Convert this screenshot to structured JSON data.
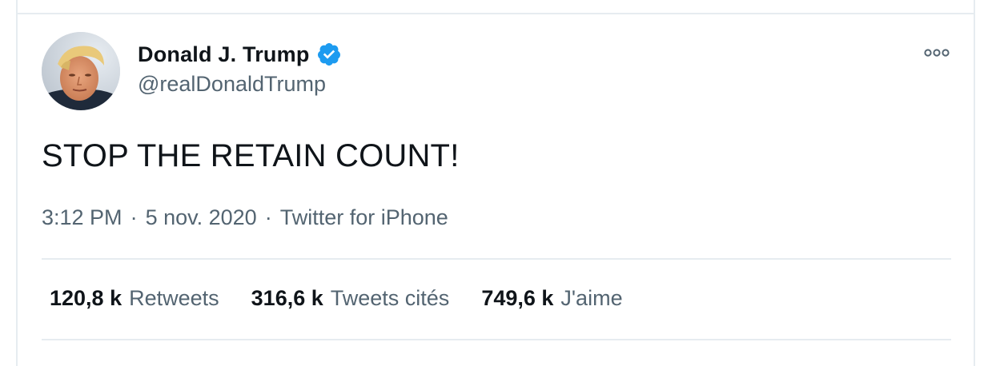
{
  "tweet": {
    "author": {
      "display_name": "Donald J. Trump",
      "handle": "@realDonaldTrump",
      "verified": true,
      "avatar_icon": "portrait-photo",
      "verified_icon": "verified-badge-icon"
    },
    "text": "STOP THE RETAIN COUNT!",
    "meta": {
      "time": "3:12 PM",
      "separator": "·",
      "date": "5 nov. 2020",
      "source": "Twitter for iPhone"
    },
    "stats": [
      {
        "count": "120,8 k",
        "label": "Retweets"
      },
      {
        "count": "316,6 k",
        "label": "Tweets cités"
      },
      {
        "count": "749,6 k",
        "label": "J'aime"
      }
    ],
    "more_icon": "more-options-icon"
  },
  "colors": {
    "text_primary": "#0f1419",
    "text_secondary": "#536471",
    "border": "#e6ecf0",
    "verified_blue": "#1d9bf0",
    "background": "#ffffff"
  }
}
